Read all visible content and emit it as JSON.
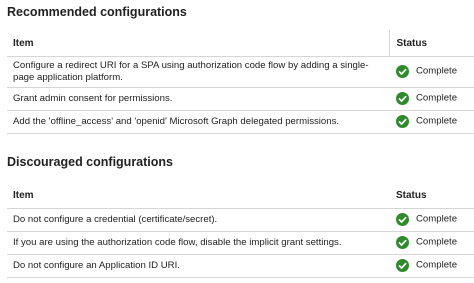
{
  "recommended": {
    "title": "Recommended configurations",
    "headers": {
      "item": "Item",
      "status": "Status"
    },
    "rows": [
      {
        "item": "Configure a redirect URI for a SPA using authorization code flow by adding a single-page application platform.",
        "status": "Complete"
      },
      {
        "item": "Grant admin consent for permissions.",
        "status": "Complete"
      },
      {
        "item": "Add the 'offline_access' and 'openid' Microsoft Graph delegated permissions.",
        "status": "Complete"
      }
    ]
  },
  "discouraged": {
    "title": "Discouraged configurations",
    "headers": {
      "item": "Item",
      "status": "Status"
    },
    "rows": [
      {
        "item": "Do not configure a credential (certificate/secret).",
        "status": "Complete"
      },
      {
        "item": "If you are using the authorization code flow, disable the implicit grant settings.",
        "status": "Complete"
      },
      {
        "item": "Do not configure an Application ID URI.",
        "status": "Complete"
      }
    ]
  },
  "colors": {
    "complete": "#2e8b29"
  },
  "icons": {
    "status": "check-circle-icon"
  }
}
